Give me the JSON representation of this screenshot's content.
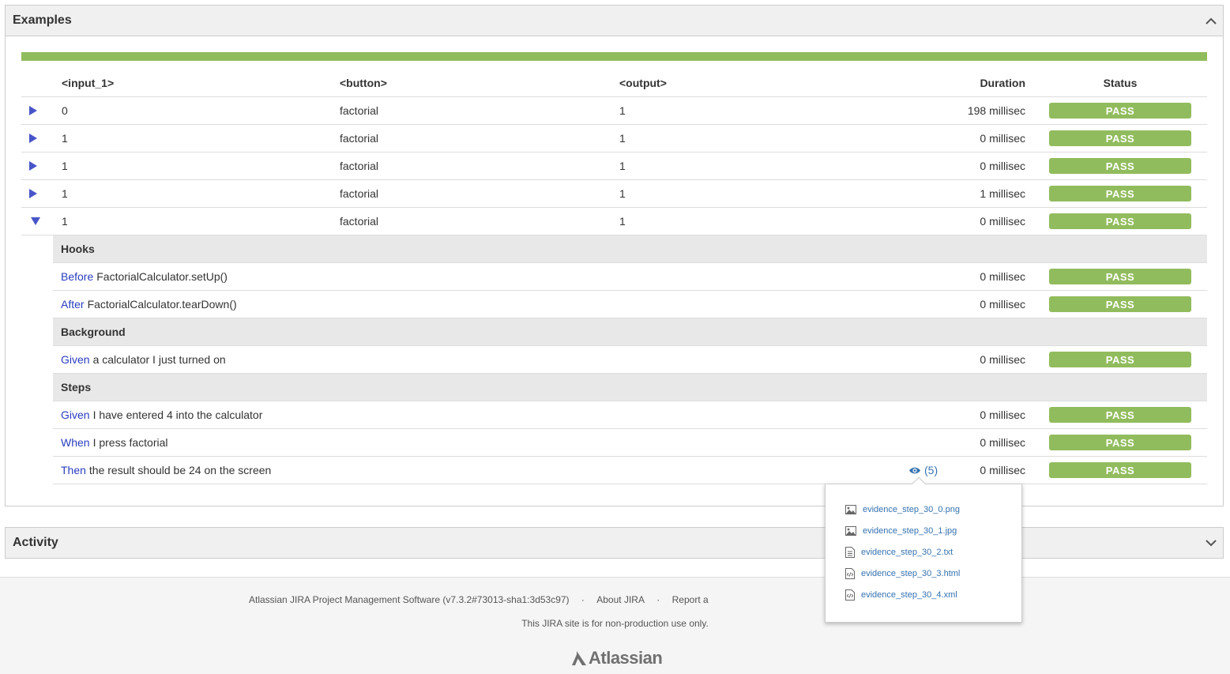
{
  "examples_panel": {
    "title": "Examples"
  },
  "table": {
    "headers": {
      "input": "<input_1>",
      "button": "<button>",
      "output": "<output>",
      "duration": "Duration",
      "status": "Status"
    },
    "rows": [
      {
        "input": "0",
        "button": "factorial",
        "output": "1",
        "duration": "198 millisec",
        "status": "PASS"
      },
      {
        "input": "1",
        "button": "factorial",
        "output": "1",
        "duration": "0 millisec",
        "status": "PASS"
      },
      {
        "input": "1",
        "button": "factorial",
        "output": "1",
        "duration": "0 millisec",
        "status": "PASS"
      },
      {
        "input": "1",
        "button": "factorial",
        "output": "1",
        "duration": "1 millisec",
        "status": "PASS"
      },
      {
        "input": "1",
        "button": "factorial",
        "output": "1",
        "duration": "0 millisec",
        "status": "PASS"
      }
    ]
  },
  "details": {
    "hooks_label": "Hooks",
    "hooks": [
      {
        "keyword": "Before",
        "text": "FactorialCalculator.setUp()",
        "duration": "0 millisec",
        "status": "PASS"
      },
      {
        "keyword": "After",
        "text": "FactorialCalculator.tearDown()",
        "duration": "0 millisec",
        "status": "PASS"
      }
    ],
    "background_label": "Background",
    "background": [
      {
        "keyword": "Given",
        "text": "a calculator I just turned on",
        "duration": "0 millisec",
        "status": "PASS"
      }
    ],
    "steps_label": "Steps",
    "steps": [
      {
        "keyword": "Given",
        "text": "I have entered 4 into the calculator",
        "duration": "0 millisec",
        "status": "PASS"
      },
      {
        "keyword": "When",
        "text": "I press factorial",
        "duration": "0 millisec",
        "status": "PASS"
      },
      {
        "keyword": "Then",
        "text": "the result should be 24 on the screen",
        "duration": "0 millisec",
        "status": "PASS",
        "evidence_count": "(5)"
      }
    ]
  },
  "evidence_popup": {
    "files": [
      {
        "name": "evidence_step_30_0.png",
        "icon": "image-icon"
      },
      {
        "name": "evidence_step_30_1.jpg",
        "icon": "image-icon"
      },
      {
        "name": "evidence_step_30_2.txt",
        "icon": "text-file-icon"
      },
      {
        "name": "evidence_step_30_3.html",
        "icon": "code-file-icon"
      },
      {
        "name": "evidence_step_30_4.xml",
        "icon": "code-file-icon"
      }
    ]
  },
  "activity_panel": {
    "title": "Activity"
  },
  "footer": {
    "software": "Atlassian JIRA Project Management Software (v7.3.2#73013-sha1:3d53c97)",
    "sep": "·",
    "about": "About JIRA",
    "report": "Report a",
    "note": "This JIRA site is for non-production use only.",
    "logo_text": "Atlassian"
  },
  "colors": {
    "pass_green": "#91bc5d",
    "keyword_blue": "#2a3dbf",
    "link_blue": "#3572b0",
    "triangle": "#4855c8"
  }
}
